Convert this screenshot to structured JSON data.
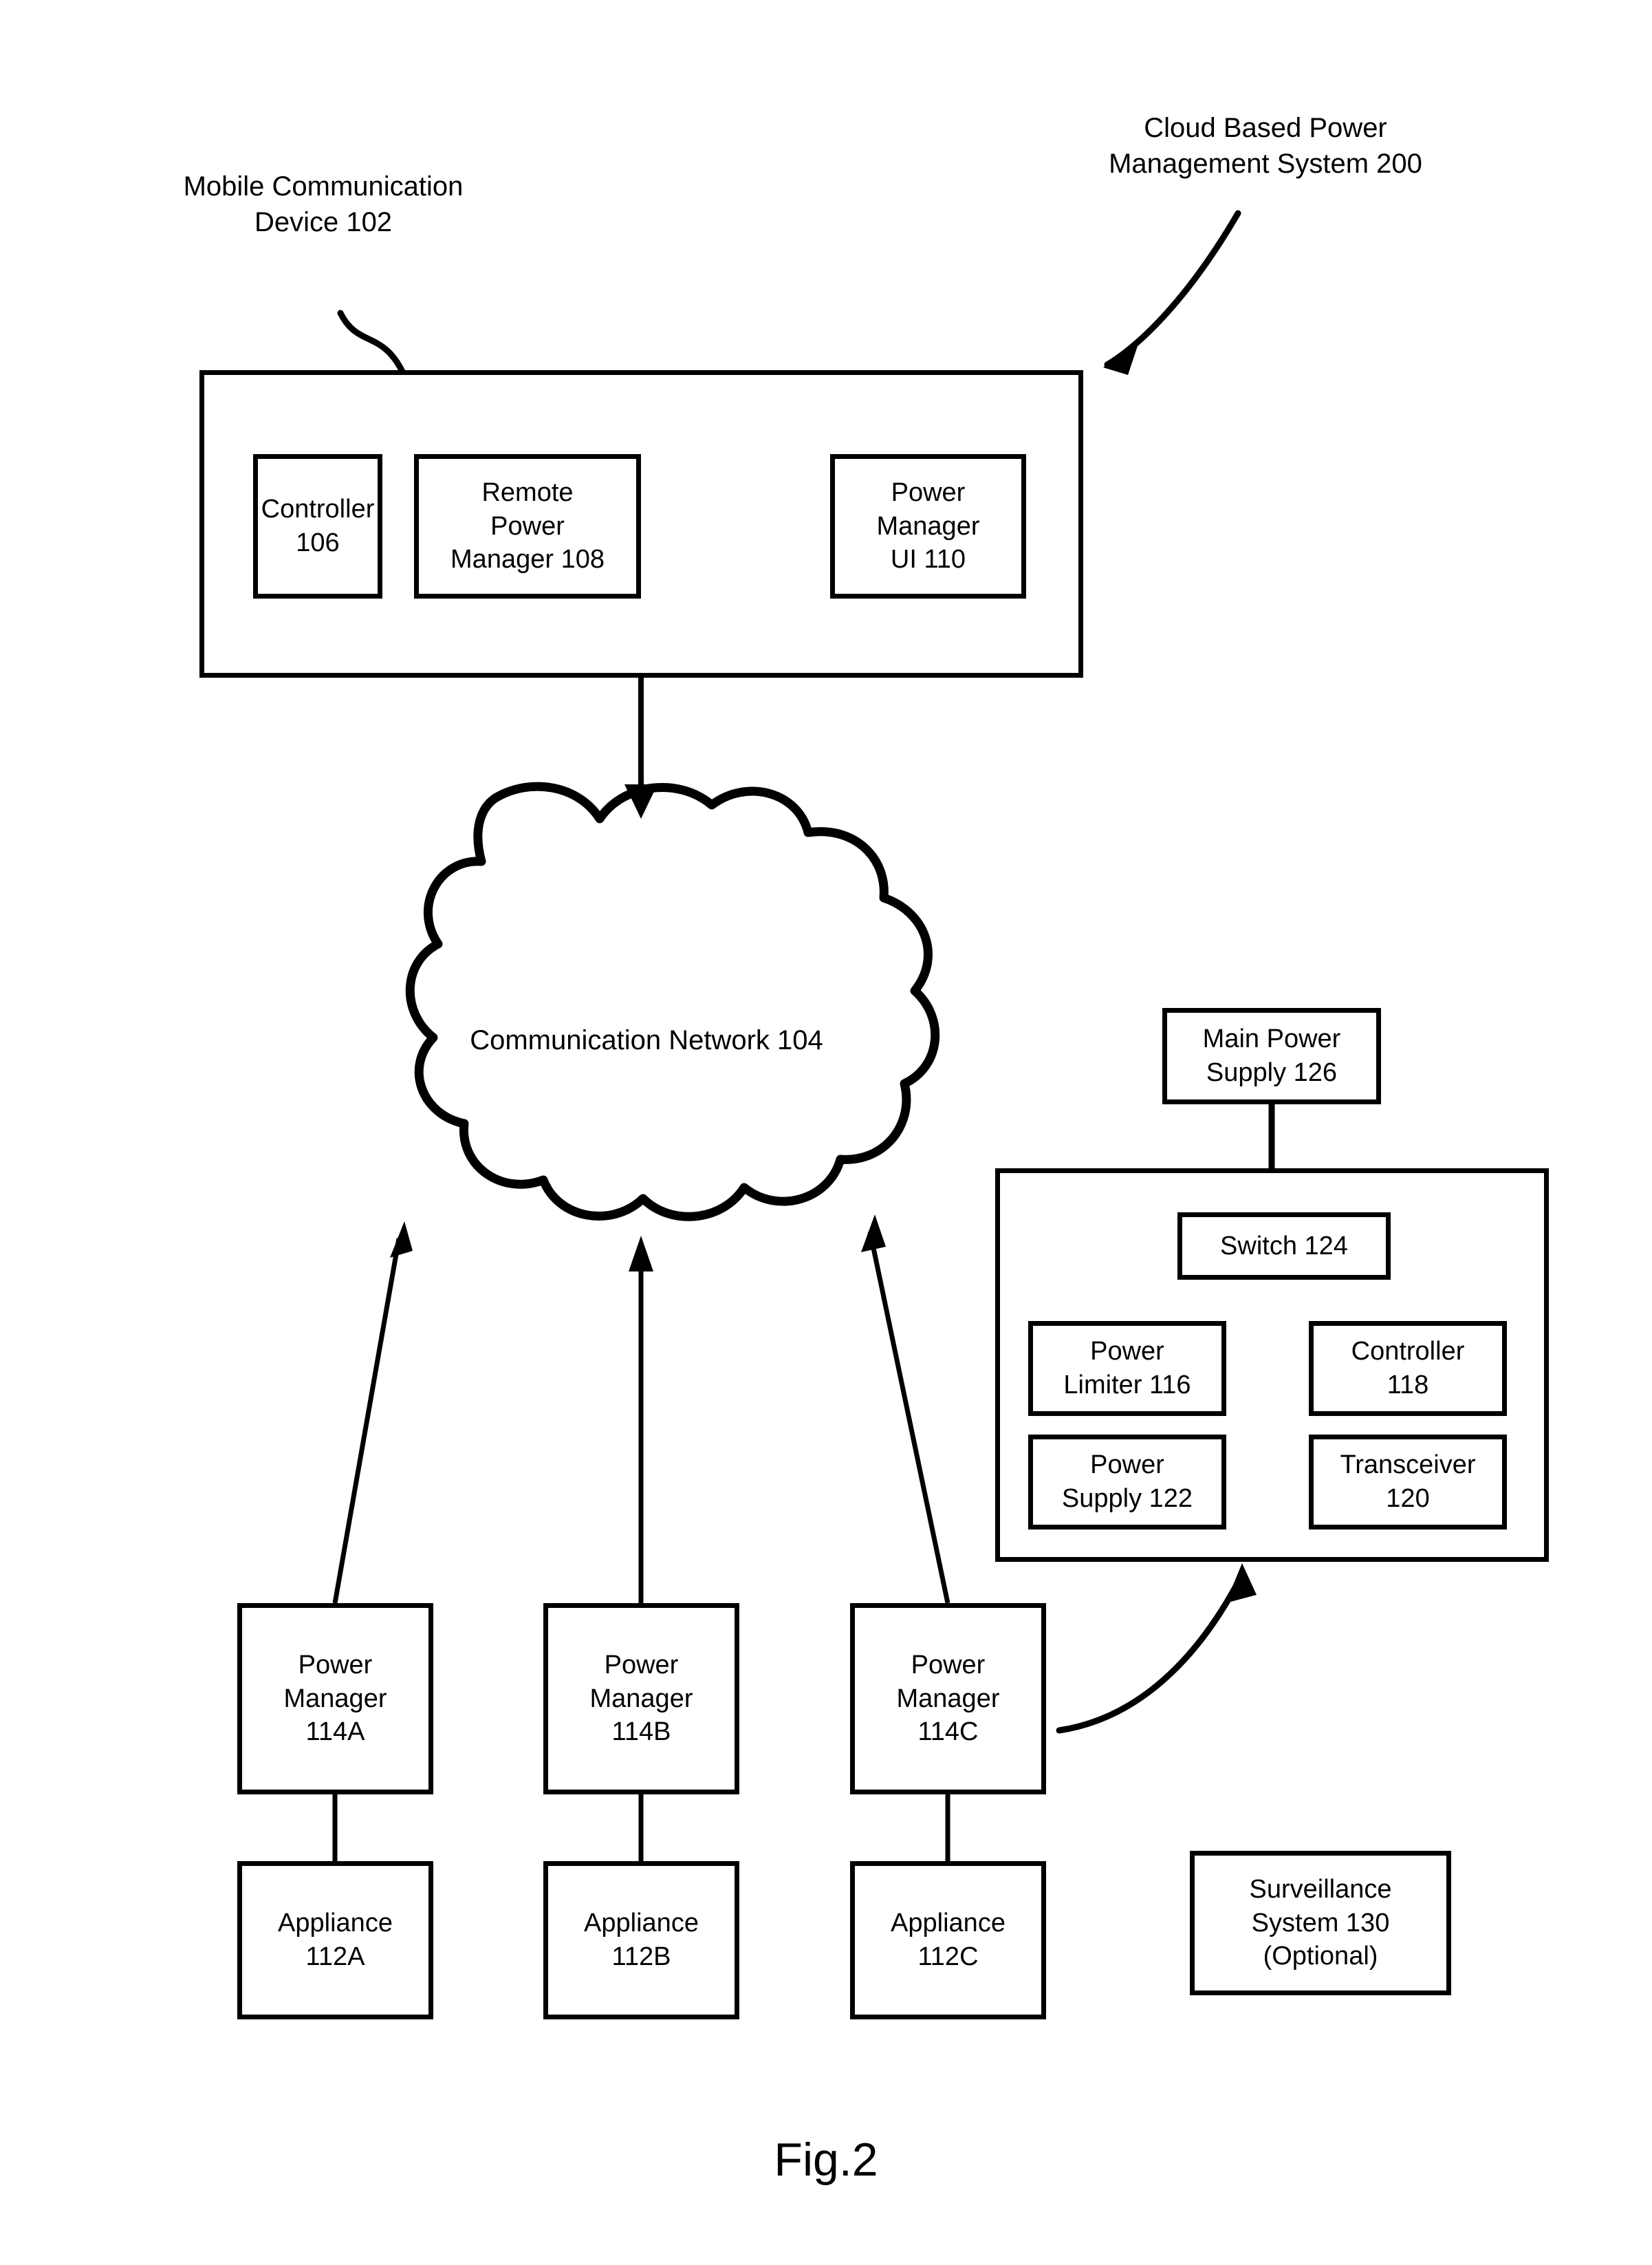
{
  "figure": {
    "caption": "Fig.2"
  },
  "callouts": {
    "mobile_device": "Mobile Communication\nDevice 102",
    "system": "Cloud Based Power\nManagement System 200"
  },
  "mobile_device_box": {
    "name": "mobile-communication-device",
    "children": [
      {
        "id": "controller-106",
        "text": "Controller\n106"
      },
      {
        "id": "remote-power-manager-108",
        "text": "Remote\nPower\nManager 108"
      },
      {
        "id": "power-manager-ui-110",
        "text": "Power\nManager\nUI 110"
      }
    ]
  },
  "cloud": {
    "label": "Communication Network 104"
  },
  "main_power_supply": {
    "text": "Main Power\nSupply 126"
  },
  "power_unit": {
    "switch": {
      "text": "Switch 124"
    },
    "grid": [
      {
        "id": "power-limiter-116",
        "text": "Power\nLimiter 116"
      },
      {
        "id": "controller-118",
        "text": "Controller\n118"
      },
      {
        "id": "power-supply-122",
        "text": "Power\nSupply 122"
      },
      {
        "id": "transceiver-120",
        "text": "Transceiver\n120"
      }
    ]
  },
  "power_managers": [
    {
      "id": "power-manager-114a",
      "text": "Power\nManager\n114A"
    },
    {
      "id": "power-manager-114b",
      "text": "Power\nManager\n114B"
    },
    {
      "id": "power-manager-114c",
      "text": "Power\nManager\n114C"
    }
  ],
  "appliances": [
    {
      "id": "appliance-112a",
      "text": "Appliance\n112A"
    },
    {
      "id": "appliance-112b",
      "text": "Appliance\n112B"
    },
    {
      "id": "appliance-112c",
      "text": "Appliance\n112C"
    }
  ],
  "surveillance_system": {
    "text": "Surveillance\nSystem 130\n(Optional)"
  },
  "colors": {
    "stroke": "#000000",
    "background": "#ffffff"
  }
}
